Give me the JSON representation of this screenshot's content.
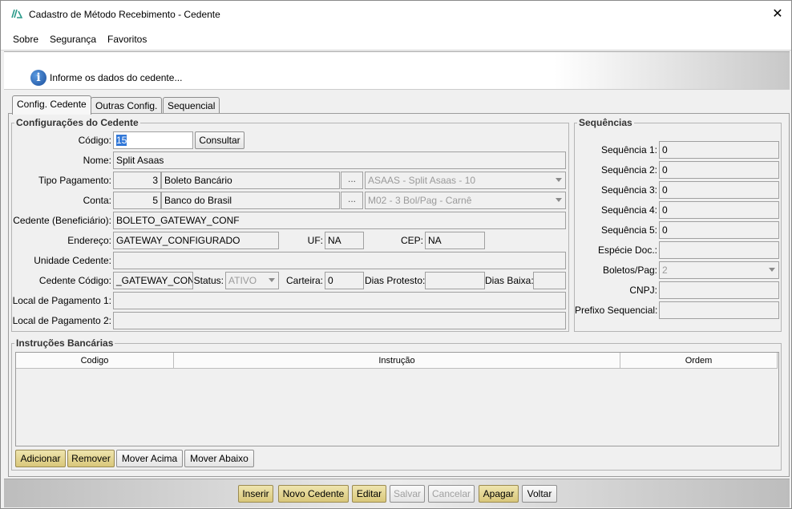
{
  "window": {
    "title": "Cadastro de Método Recebimento - Cedente",
    "close_label": "✕"
  },
  "menu": {
    "items": [
      "Sobre",
      "Segurança",
      "Favoritos"
    ]
  },
  "header": {
    "info_text": "Informe os dados do cedente..."
  },
  "tabs": [
    "Config. Cedente",
    "Outras Config.",
    "Sequencial"
  ],
  "config": {
    "title": "Configurações do Cedente",
    "codigo_label": "Código:",
    "codigo": "15",
    "consultar": "Consultar",
    "nome_label": "Nome:",
    "nome": "Split Asaas",
    "tipo_label": "Tipo Pagamento:",
    "tipo_num": "3",
    "tipo_desc": "Boleto Bancário",
    "tipo_sel": "ASAAS - Split Asaas - 10",
    "conta_label": "Conta:",
    "conta_num": "5",
    "conta_desc": "Banco do Brasil",
    "conta_sel": "M02 - 3 Bol/Pag - Carnê",
    "ellipsis": "...",
    "cedente_label": "Cedente (Beneficiário):",
    "cedente": "BOLETO_GATEWAY_CONF",
    "endereco_label": "Endereço:",
    "endereco": "GATEWAY_CONFIGURADO",
    "uf_label": "UF:",
    "uf": "NA",
    "cep_label": "CEP:",
    "cep": "NA",
    "unidade_label": "Unidade Cedente:",
    "unidade": "",
    "ced_cod_label": "Cedente Código:",
    "ced_cod": "_GATEWAY_CONF",
    "status_label": "Status:",
    "status": "ATIVO",
    "carteira_label": "Carteira:",
    "carteira": "0",
    "protesto_label": "Dias Protesto:",
    "protesto": "",
    "baixa_label": "Dias Baixa:",
    "baixa": "",
    "local1_label": "Local de Pagamento 1:",
    "local1": "",
    "local2_label": "Local de Pagamento 2:",
    "local2": ""
  },
  "seq": {
    "title": "Sequências",
    "rows": [
      {
        "label": "Sequência 1:",
        "value": "0"
      },
      {
        "label": "Sequência 2:",
        "value": "0"
      },
      {
        "label": "Sequência 3:",
        "value": "0"
      },
      {
        "label": "Sequência 4:",
        "value": "0"
      },
      {
        "label": "Sequência 5:",
        "value": "0"
      },
      {
        "label": "Espécie Doc.:",
        "value": ""
      },
      {
        "label": "Boletos/Pag:",
        "value": "2"
      },
      {
        "label": "CNPJ:",
        "value": ""
      },
      {
        "label": "Prefixo Sequencial:",
        "value": ""
      }
    ]
  },
  "instr": {
    "title": "Instruções Bancárias",
    "columns": [
      "Codigo",
      "Instrução",
      "Ordem"
    ],
    "buttons": [
      "Adicionar",
      "Remover",
      "Mover Acima",
      "Mover Abaixo"
    ]
  },
  "footer": {
    "buttons": [
      "Inserir",
      "Novo Cedente",
      "Editar",
      "Salvar",
      "Cancelar",
      "Apagar",
      "Voltar"
    ]
  }
}
